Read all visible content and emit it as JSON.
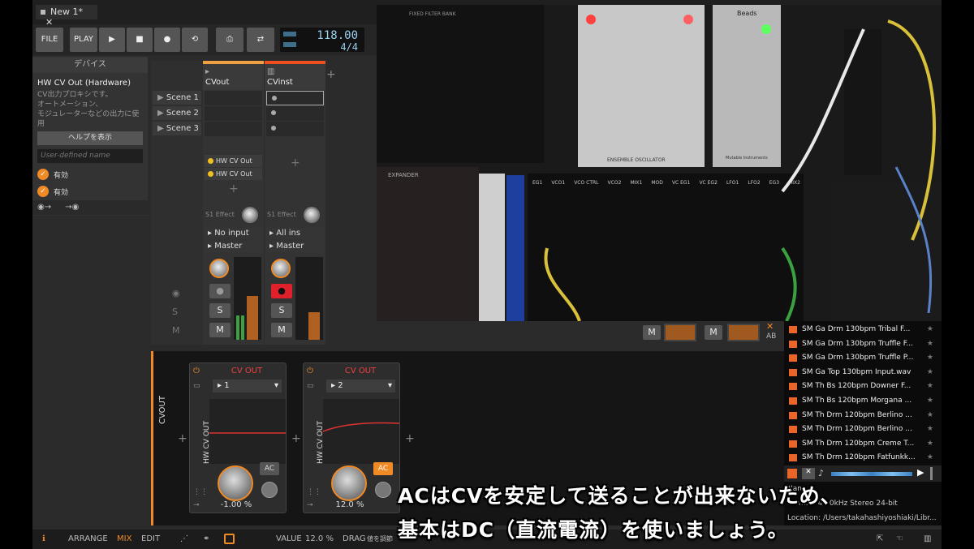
{
  "tabbar": {
    "tab_label": "New 1*",
    "close": "✕"
  },
  "transport": {
    "file": "FILE",
    "play": "PLAY",
    "tempo": "118.00",
    "time_signature": "4/4"
  },
  "inspector": {
    "header": "デバイス",
    "device_title": "HW CV Out (Hardware)",
    "desc_1": "CV出力プロキシです。",
    "desc_2": "オートメーション、",
    "desc_3": "モジュレーターなどの出力に使用",
    "help_button": "ヘルプを表示",
    "user_name_placeholder": "User-defined name",
    "enabled_1": "有効",
    "enabled_2": "有効"
  },
  "scenes": [
    "Scene 1",
    "Scene 2",
    "Scene 3"
  ],
  "channels": [
    {
      "name": "CVout",
      "device_1": "HW CV Out",
      "device_2": "HW CV Out",
      "effect": "S1 Effect",
      "input": "No input",
      "output": "Master",
      "s": "S",
      "m": "M"
    },
    {
      "name": "CVinst",
      "effect": "S1 Effect",
      "input": "All ins",
      "output": "Master",
      "s": "S",
      "m": "M"
    }
  ],
  "device_panel": {
    "track_label": "CVOUT",
    "cards": [
      {
        "title": "CV OUT",
        "channel": "1",
        "side_label": "HW CV OUT",
        "value": "-1.00 %",
        "ac": "AC",
        "ac_active": false
      },
      {
        "title": "CV OUT",
        "channel": "2",
        "side_label": "HW CV OUT",
        "value": "12.0 %",
        "ac": "AC",
        "ac_active": true
      }
    ]
  },
  "browser": {
    "items": [
      "SM Ga Drm 130bpm Tribal F...",
      "SM Ga Drm 130bpm Truffle F...",
      "SM Ga Drm 130bpm Truffle P...",
      "SM Ga Top 130bpm Input.wav",
      "SM Th Bs 120bpm Downer F...",
      "SM Th Bs 120bpm Morgana ...",
      "SM Th Drm 120bpm Berlino ...",
      "SM Th Drm 120bpm Berlino ...",
      "SM Th Drm 120bpm Creme T...",
      "SM Th Drm 120bpm Fatfunkk..."
    ],
    "info_1": "Nam...",
    "info_2": "Format: 48.0kHz Stereo 24-bit",
    "info_3": "Location: /Users/takahashiyoshiaki/Libr..."
  },
  "video_labels": {
    "filter_bank": "FIXED FILTER BANK",
    "ensemble": "ENSEMBLE OSCILLATOR",
    "beads": "Beads",
    "mutable": "Mutable Instruments",
    "expander": "EXPANDER",
    "patch_labels": [
      "EG1",
      "VCO1",
      "VCO CTRL",
      "VCO2",
      "MIX1",
      "MOD",
      "VC EG1",
      "VC EG2",
      "LFO1",
      "LFO2",
      "EG3",
      "MIX2"
    ]
  },
  "mixer_buttons": {
    "m": "M",
    "ab": "AB"
  },
  "status": {
    "arrange": "ARRANGE",
    "mix": "MIX",
    "edit": "EDIT",
    "value_label": "VALUE",
    "value": "12.0 %",
    "drag_label": "DRAG",
    "drag_hint": "値を調節"
  },
  "subtitle": {
    "line1": "ACはCVを安定して送ることが出来ないため、",
    "line2": "基本はDC（直流電流）を使いましょう。"
  },
  "colors": {
    "accent": "#f08a24",
    "cv_red": "#f04040",
    "tempo": "#9ad0f0"
  }
}
